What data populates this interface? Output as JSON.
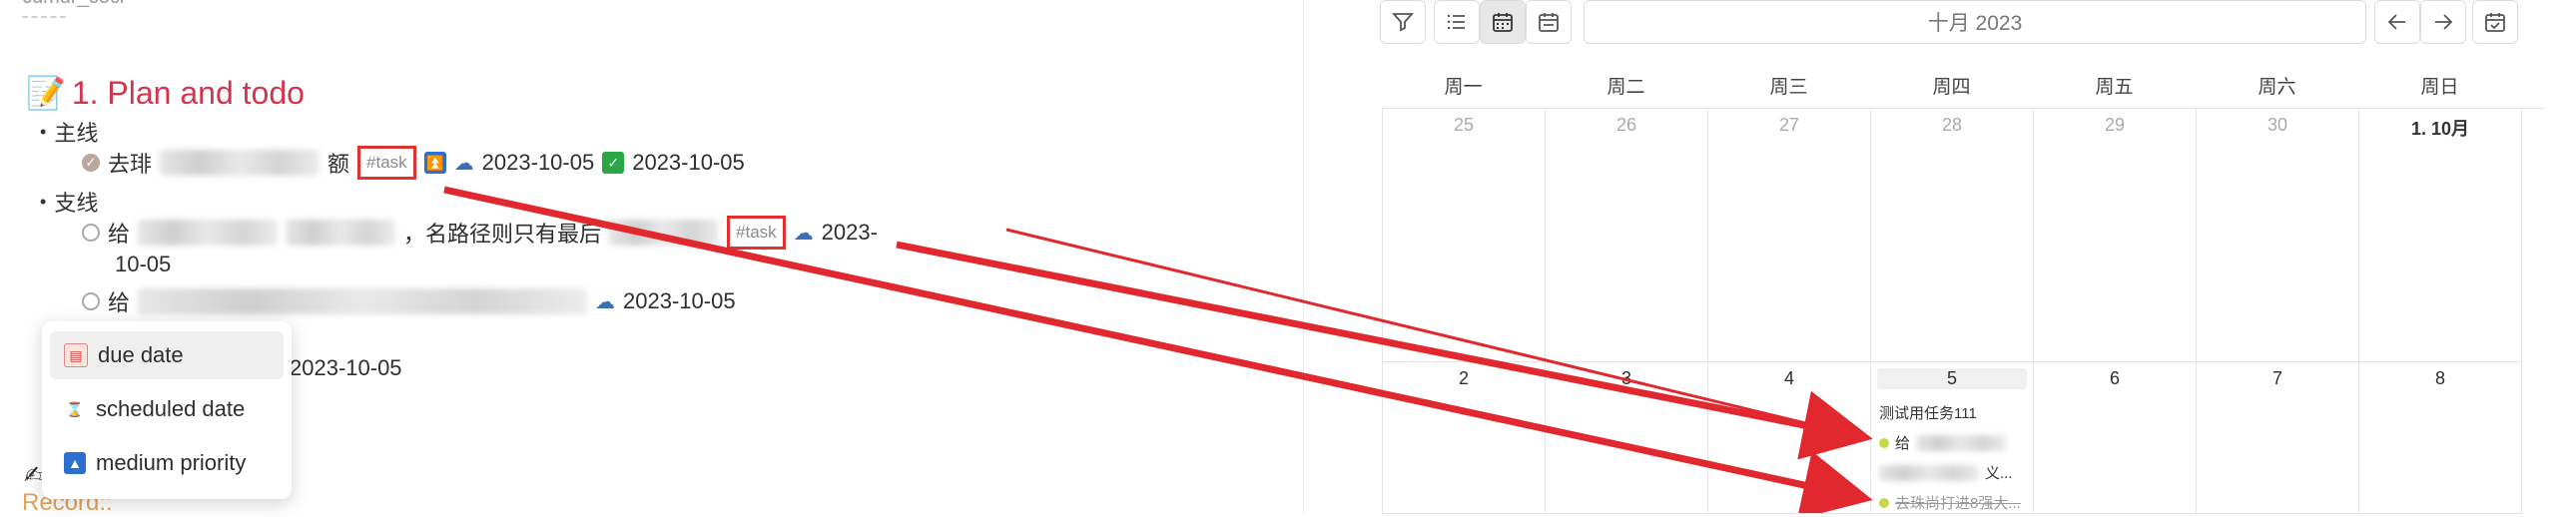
{
  "note": {
    "frontmatter": "cumur_cocr ·",
    "heading": "1. Plan and todo",
    "sections": [
      {
        "label": "主线"
      },
      {
        "label": "支线"
      }
    ],
    "task1": {
      "prefix": "去琲",
      "suffix": "额",
      "tag": "#task",
      "date1": "2023-10-05",
      "date2": "2023-10-05"
    },
    "task2": {
      "prefix": "给",
      "middle": "，名路径则只有最后",
      "tag": "#task",
      "date": "2023-",
      "date_wrap": "10-05"
    },
    "task3": {
      "prefix": "给",
      "date": "2023-10-05"
    },
    "task4": {
      "date": "2023-10-05"
    },
    "record": "Record::"
  },
  "popup": {
    "items": [
      {
        "label": "due date",
        "icon": "calendar-icon"
      },
      {
        "label": "scheduled date",
        "icon": "hourglass-icon"
      },
      {
        "label": "medium priority",
        "icon": "priority-up-icon"
      }
    ]
  },
  "toolbar": {
    "month_label": "十月 2023",
    "icons": [
      "filter-icon",
      "list-icon",
      "calendar-icon",
      "calendar-week-icon",
      "arrow-left-icon",
      "arrow-right-icon",
      "calendar-check-icon"
    ]
  },
  "calendar": {
    "weekdays": [
      "周一",
      "周二",
      "周三",
      "周四",
      "周五",
      "周六",
      "周日"
    ],
    "week1": [
      "25",
      "26",
      "27",
      "28",
      "29",
      "30",
      "1. 10月"
    ],
    "week2": [
      "2",
      "3",
      "4",
      "5",
      "6",
      "7",
      "8"
    ],
    "events": [
      {
        "label": "测试用任务111",
        "dot": false,
        "strike": false
      },
      {
        "label": "给",
        "dot": true,
        "strike": false
      },
      {
        "label": "义...",
        "dot": false,
        "strike": false
      },
      {
        "label": "去珠尚打进8强大...",
        "dot": true,
        "strike": true
      }
    ]
  },
  "colors": {
    "heading": "#d1364f",
    "tag_border": "#e03030",
    "arrow": "#e0282e",
    "event_dot": "#c9d64a"
  }
}
